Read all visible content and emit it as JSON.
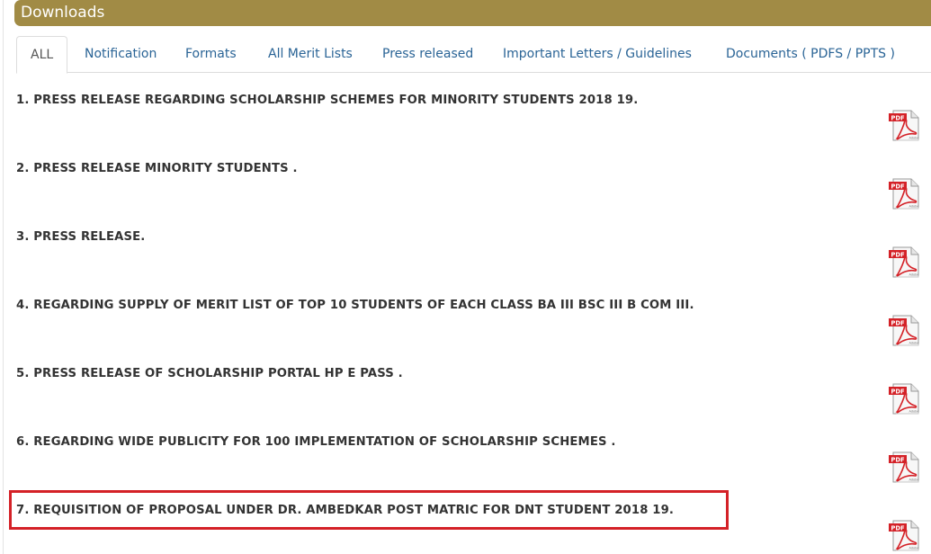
{
  "header": {
    "title": "Downloads"
  },
  "tabs": [
    {
      "label": "ALL",
      "active": true
    },
    {
      "label": "Notification"
    },
    {
      "label": "Formats"
    },
    {
      "label": "All Merit Lists"
    },
    {
      "label": "Press released"
    },
    {
      "label": "Important Letters / Guidelines"
    },
    {
      "label": "Documents ( PDFS / PPTS )"
    }
  ],
  "items": [
    {
      "text": "1. PRESS RELEASE REGARDING SCHOLARSHIP SCHEMES FOR MINORITY STUDENTS 2018 19.",
      "icon_label": "PDF"
    },
    {
      "text": "2. PRESS RELEASE MINORITY STUDENTS .",
      "icon_label": "PDF"
    },
    {
      "text": "3. PRESS RELEASE.",
      "icon_label": "PDF"
    },
    {
      "text": "4. REGARDING SUPPLY OF MERIT LIST OF TOP 10 STUDENTS OF EACH CLASS BA III BSC III B COM III.",
      "icon_label": "PDF"
    },
    {
      "text": "5. PRESS RELEASE OF SCHOLARSHIP PORTAL HP E PASS .",
      "icon_label": "PDF"
    },
    {
      "text": "6. REGARDING WIDE PUBLICITY FOR 100 IMPLEMENTATION OF SCHOLARSHIP SCHEMES .",
      "icon_label": "PDF"
    },
    {
      "text": "7. REQUISITION OF PROPOSAL UNDER DR. AMBEDKAR POST MATRIC FOR DNT STUDENT 2018 19.",
      "icon_label": "PDF"
    }
  ],
  "colors": {
    "header_bg": "#a18b45",
    "tab_link": "#2a6496",
    "highlight_border": "#d42127",
    "pdf_red": "#d42127"
  }
}
